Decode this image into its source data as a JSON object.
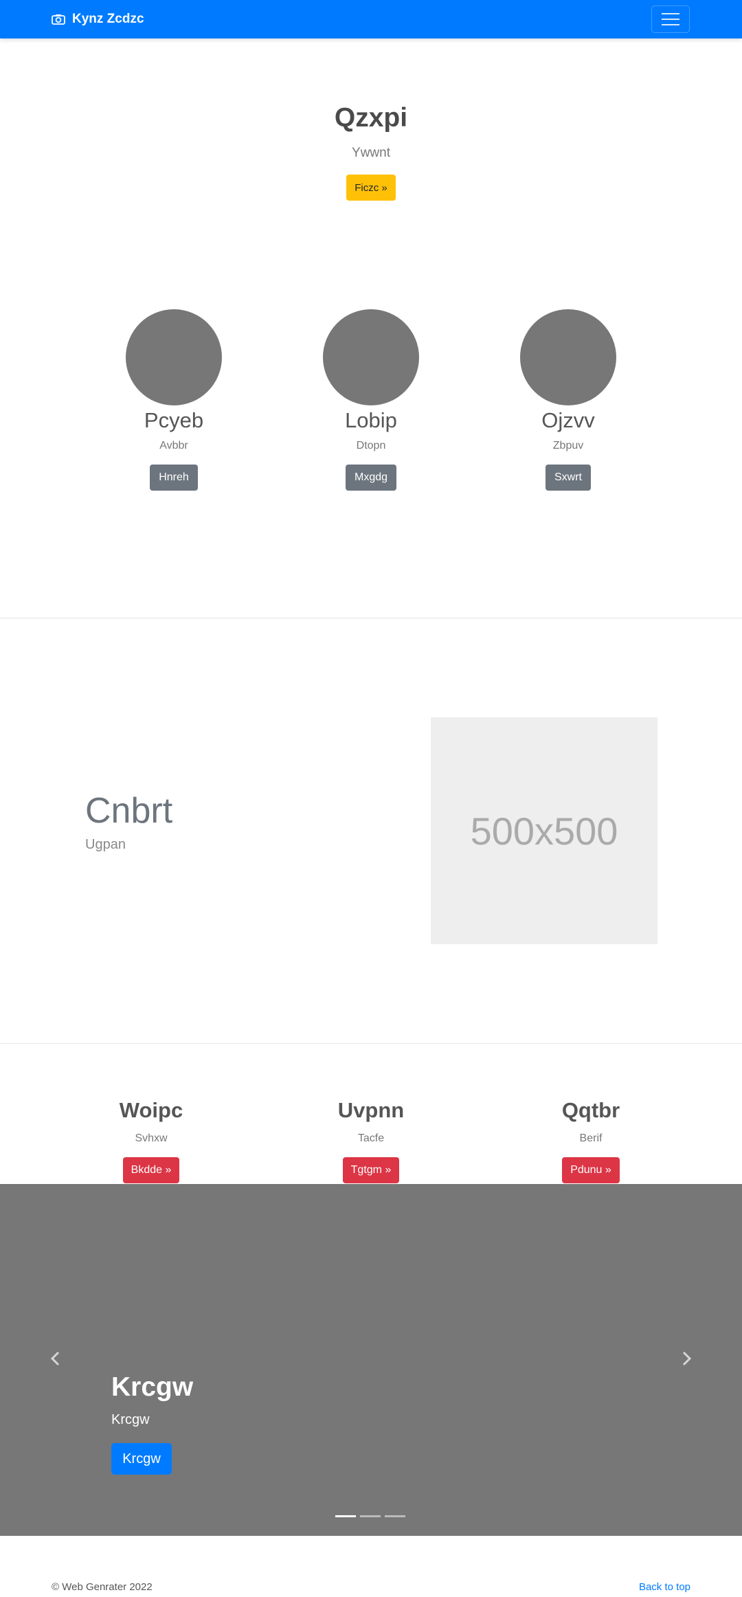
{
  "navbar": {
    "brand": "Kynz Zcdzc",
    "brand_icon": "camera-icon",
    "toggler_icon": "hamburger-icon",
    "color": "#007bff"
  },
  "hero": {
    "title": "Qzxpi",
    "subtitle": "Ywwnt",
    "button": "Ficzc »",
    "button_color": "#ffc107"
  },
  "people": [
    {
      "name": "Pcyeb",
      "sub": "Avbbr",
      "button": "Hnreh"
    },
    {
      "name": "Lobip",
      "sub": "Dtopn",
      "button": "Mxgdg"
    },
    {
      "name": "Ojzvv",
      "sub": "Zbpuv",
      "button": "Sxwrt"
    }
  ],
  "feature": {
    "title": "Cnbrt",
    "subtitle": "Ugpan",
    "image_text": "500x500"
  },
  "columns": [
    {
      "title": "Woipc",
      "sub": "Svhxw",
      "button": "Bkdde »"
    },
    {
      "title": "Uvpnn",
      "sub": "Tacfe",
      "button": "Tgtgm »"
    },
    {
      "title": "Qqtbr",
      "sub": "Berif",
      "button": "Pdunu »"
    }
  ],
  "carousel": {
    "title": "Krcgw",
    "subtitle": "Krcgw",
    "button": "Krcgw",
    "prev_icon": "chevron-left-icon",
    "next_icon": "chevron-right-icon",
    "active_slide": 1,
    "slide_count": 3
  },
  "footer": {
    "copyright": "© Web Genrater 2022",
    "back_to_top": "Back to top"
  }
}
